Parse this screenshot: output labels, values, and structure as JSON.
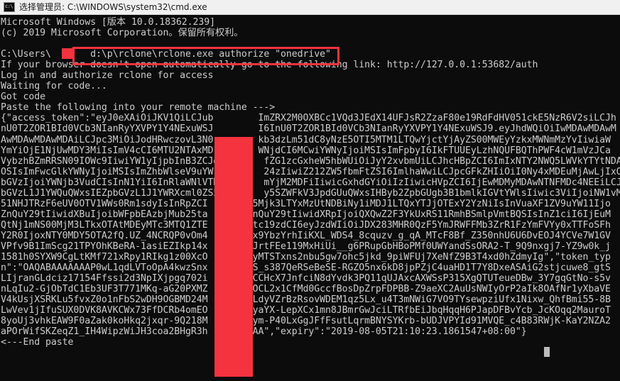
{
  "window": {
    "title": "选择管理员: C:\\WINDOWS\\system32\\cmd.exe",
    "icon": "cmd-console-icon",
    "titlebar_bg": "#f0f0f0",
    "console_bg": "#0c0c0c",
    "console_fg": "#cccccc"
  },
  "annotations": {
    "highlight_color": "#f5333f",
    "command_box_label": "red-rectangle-around-authorize-command",
    "username_redaction_label": "red-block-over-username",
    "token_redaction_label": "red-vertical-block-over-token"
  },
  "terminal": {
    "banner_line_1": "Microsoft Windows [版本 10.0.18362.239]",
    "banner_line_2": "(c) 2019 Microsoft Corporation。保留所有权利。",
    "prompt": "C:\\Users\\",
    "command": "d:\\p\\rclone\\rclone.exe authorize \"onedrive\"",
    "msg_browser": "If your browser doesn't open automatically go to the following link: http://127.0.0.1:53682/auth",
    "auth_url": "http://127.0.0.1:53682/auth",
    "msg_login": "Log in and authorize rclone for access",
    "msg_waiting": "Waiting for code...",
    "msg_gotcode": "Got code",
    "msg_paste_start": "Paste the following into your remote machine --->",
    "msg_paste_end": "<---End paste",
    "token_expiry": "2019-08-05T21:10:23.1861547+08:00",
    "token_type_key": "token_type",
    "full_text": "Microsoft Windows [版本 10.0.18362.239]\n(c) 2019 Microsoft Corporation。保留所有权利。\n\nC:\\Users\\       d:\\p\\rclone\\rclone.exe authorize \"onedrive\"\nIf your browser doesn't open automatically go to the following link: http://127.0.0.1:53682/auth\nLog in and authorize rclone for access\nWaiting for code...\nGot code\nPaste the following into your remote machine --->\n{\"access_token\":\"eyJ0eXAiOiJKV1QiLCJub        ImZRX2M0OXBCc1VQd3JEdX14UFJsR2ZzaF80e19RdFdHV051ckE5NzR6V2siLCJh\nnU0T2ZOR1BId0VCb3NIanRyYXVPY1Y4NExuWSJ        I6InU0T2ZOR1BId0VCb3NIanRyYXVPY1Y4NExuWSJ9.eyJhdWQiOiIwMDAwMDAwM\nAwMDAwMDAwMDAiLCJpc3MiOiJodHRwczovL3N0        kb3dzLm51dC8yNzE5OTI5MTM1LTQwYjctYjAyZS00MWEyYzkxMWNmMzYvIiwiaW\nYmYiOjE1NjUwMDY3MiIsImV4cCI6MTU2NTAxMD        WNjdCI6MCwiYWNyIjoiMSIsImFpbyI6IkFTUUEyLzhNQUFBQThPWF4cW1mVzJCa\nVybzhBZmRRSN09IOWc9IiwiYW1yIjpbInB3ZCJd        fZG1zcGxheW5hbWUiOiJyY2xvbmUiLCJhcHBpZCI6ImIxNTY2NWQ5LWVkYTYtNDA\nOSIsImFwcGlkYWNyIjoiMSIsImZhbWlseV9uYW1        24zIiwiZ212ZW5fbmFtZSI6ImlhaWwiLCJpcGFkZHIiOiI0Ny4xMDEuMjAwLjIxO\nbGVzIjoiYWNjb3VudCIsInN1YiI6InRlaWNlVTN        mYjM2MDFiIiwicGxhdGYiOiIzIiwicHVpZCI6IjEwMDMyMDAwNTNFMDc4NEEiLCJ\nbGVzL1J1YWQuQWxsIEZpbGVzL1J1YWRXcml0ZS5        y5SZWFkV3JpdGUuQWxsIHByb2ZpbGUgb3B1bmlkIGVtYWlsIiwic3ViIjoiNW1vM\n51NHJTRzF6eUV0OTV1WWs0Rm1sdyIsInRpZCI        5Mjk3LTYxMzUtNDBiNy1iMDJ1LTQxYTJjOTExY2YzNiIsInVuaXF1ZV9uYW11Ijo\nZnQuY29tIiwidXBuIjoibWFpbEAzbjMub25ta        nQuY29tIiwidXRpIjoiQXQwZ2F3YkUxRS11RmhBSmlpVmtBQSIsInZ1ciI6IjEuM\nQtNj1mNS00MjM3LTkxOTAtMDEyMTc3MTQ1ZTE        tc19zdCI6eyJzdWIiOiJDX283MHR0QzF5YmJRWFFMb3ZrR1FzYmFVYy0xTTFoSFh\nY2R0IjoxNTY0MDY5OTA2fQ.UZ_4NCRQP0vOm4        x9YbzYrhIiKXL_WDS4_8cquzv_g_qA_MTcF8Bf_Z350nhU6U6DvEOJ4YCVe7W1GV\nVPfv9B1ImScg21TPYOhKBeRA-1asiEZIkp14x        JrtFEe119MxHiUi__g6PRupGbHBoPMf0UWYandSsORA2-T_9Q9nxgj7-YZ9w0k_j\n1581h0SYXW9CgLtKMf721xRpy1RIkg1z00XcO        yMTSTxns2nbu5gw7ohc5jkd_9piWFUj7XeNfZ9B3T4xd0hZdmyIg\",\"token_typ\nn\":\"OAQABAAAAAAAP0wL1qdLVToOpA4kwzSnx        S_s387QeRSeBeSE-RGZO5nx6kD8jpPZjC4uaHD1T7Y8DxeASAiG2stjcuwe8_gtS\nLIjranGLdciz17154Ffssi2d3NpIXjpgq702i        CCHcX7JnfciN8dYvdk3PQ11qUJAxcAXWSsP315XgQTUTeueDBw_3Y7gqGtNo-s5v\nnLqIu2-GjObTdC1Eb3UF3T771MKq-aG20PXMZ        OCL2x1CfMd0GccfBosDpZrpFDPBB-Z9aeXC2AuUsNWIyOrP2aIk8OAfNr1yXbaVE\nV4kUsjXSRKLu5fvxZ0o1nFbS2wDH9OGBMD24M        LdyVZrBzRsovWDEM1qz5Lx_u4T3mNWiG7VO9TYsewpziUfx1Nixw_QhfBmi55-8B\nLwVev1jIfuSUX0DVK8AVKCWx73FfDCRb4omEO        yaYX-LepXCx1mn8JBmrGwJciLTRfbEiJbqHqqH6PJapDFBvYcb_JcKOqq2MauroT\n8yoUj3vhkEAW9F0aZak0koHkq2jxqr-9Q218M        ym-P40LxGgJFfFsutLqrmBNYSYKrb-bUDJVPYId91MVQE_c4B83RWjK-KaY2NZA2\naPOrWifSKZeqZ1_IH4WipzWiJH3coa2BHgR3h        AA\",\"expiry\":\"2019-08-05T21:10:23.1861547+08:00\"}\n<---End paste"
  }
}
